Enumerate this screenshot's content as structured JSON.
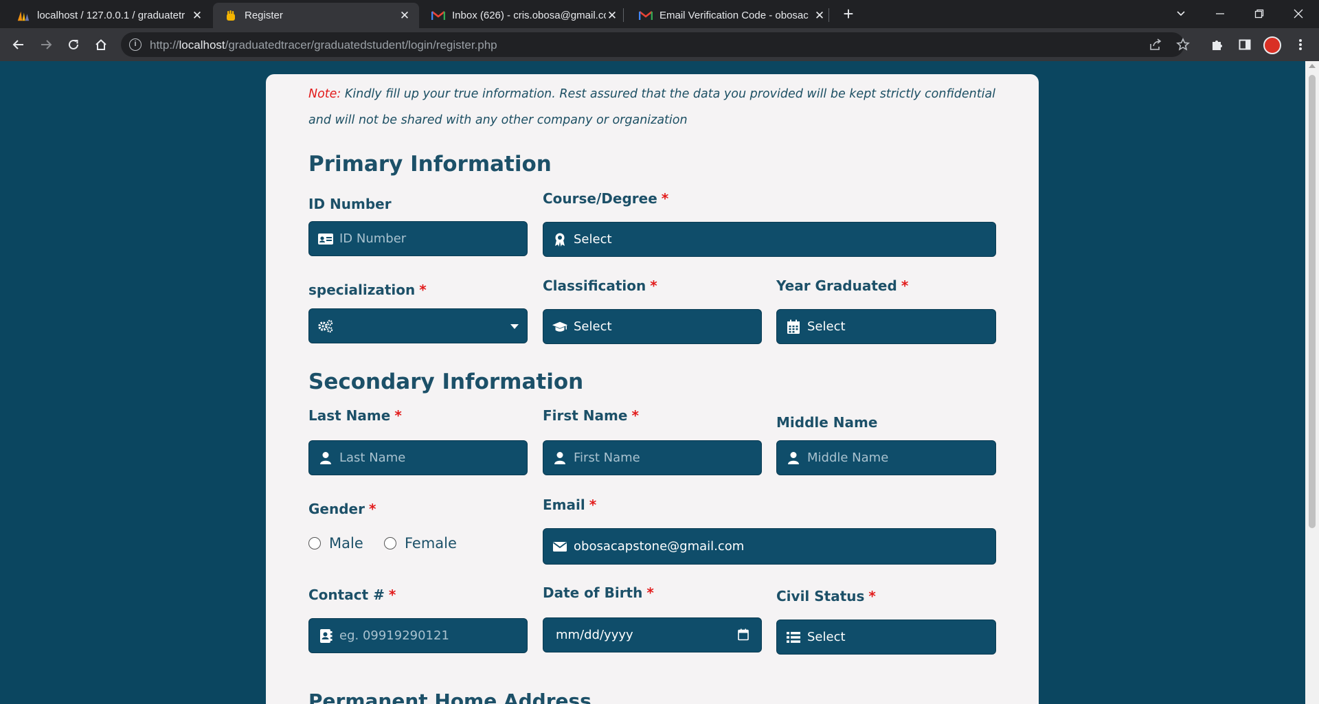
{
  "browser": {
    "tabs": [
      {
        "title": "localhost / 127.0.0.1 / graduatetr",
        "active": false
      },
      {
        "title": "Register",
        "active": true
      },
      {
        "title": "Inbox (626) - cris.obosa@gmail.co",
        "active": false
      },
      {
        "title": "Email Verification Code - obosac",
        "active": false
      }
    ],
    "url_prefix": "http://",
    "url_host": "localhost",
    "url_path": "/graduatedtracer/graduatedstudent/login/register.php",
    "accent": "#0b4660"
  },
  "page": {
    "note_label": "Note:",
    "note_text": " Kindly fill up your true information. Rest assured that the data you provided will be kept strictly confidential and will not be shared with any other company or organization",
    "primary_title": "Primary Information",
    "secondary_title": "Secondary Information",
    "next_section_title": "Permanent Home Address",
    "required_mark": "*",
    "fields": {
      "id_number": {
        "label": "ID Number",
        "placeholder": "ID Number"
      },
      "course": {
        "label": "Course/Degree",
        "value": "Select"
      },
      "specialization": {
        "label": "specialization",
        "value": ""
      },
      "classification": {
        "label": "Classification",
        "value": "Select"
      },
      "year_graduated": {
        "label": "Year Graduated",
        "value": "Select"
      },
      "last_name": {
        "label": "Last Name",
        "placeholder": "Last Name"
      },
      "first_name": {
        "label": "First Name",
        "placeholder": "First Name"
      },
      "middle_name": {
        "label": "Middle Name",
        "placeholder": "Middle Name"
      },
      "gender": {
        "label": "Gender",
        "options": [
          "Male",
          "Female"
        ]
      },
      "email": {
        "label": "Email",
        "value": "obosacapstone@gmail.com"
      },
      "contact": {
        "label": "Contact #",
        "placeholder": "eg. 09919290121"
      },
      "dob": {
        "label": "Date of Birth",
        "value": "mm/dd/yyyy"
      },
      "civil_status": {
        "label": "Civil Status",
        "value": "Select"
      }
    }
  }
}
